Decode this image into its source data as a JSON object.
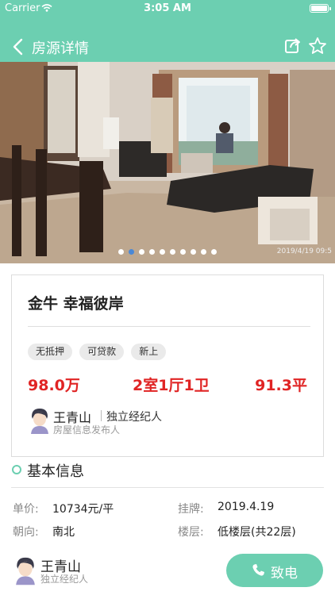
{
  "status_bar": {
    "carrier": "Carrier",
    "time": "3:05 AM"
  },
  "nav": {
    "title": "房源详情"
  },
  "photo": {
    "stamp": "2019/4/19  09:5",
    "dot_count": 10,
    "active_dot": 2
  },
  "listing": {
    "title": "金牛 幸福彼岸",
    "tags": [
      "无抵押",
      "可贷款",
      "新上"
    ],
    "price": "98.0万",
    "layout": "2室1厅1卫",
    "area": "91.3平",
    "agent": {
      "name": "王青山",
      "role": "独立经纪人",
      "subtitle": "房屋信息发布人"
    }
  },
  "basic_info": {
    "title": "基本信息",
    "unit_price_label": "单价:",
    "unit_price_value": "10734元/平",
    "listing_date_label": "挂牌:",
    "listing_date_value": "2019.4.19",
    "orientation_label": "朝向:",
    "orientation_value": "南北",
    "floor_label": "楼层:",
    "floor_value": "低楼层(共22层)"
  },
  "bottom": {
    "agent_name": "王青山",
    "agent_role": "独立经纪人",
    "call_label": "致电"
  },
  "colors": {
    "accent": "#6ccfb1",
    "price_red": "#e02424",
    "active_dot": "#4a88d6"
  }
}
